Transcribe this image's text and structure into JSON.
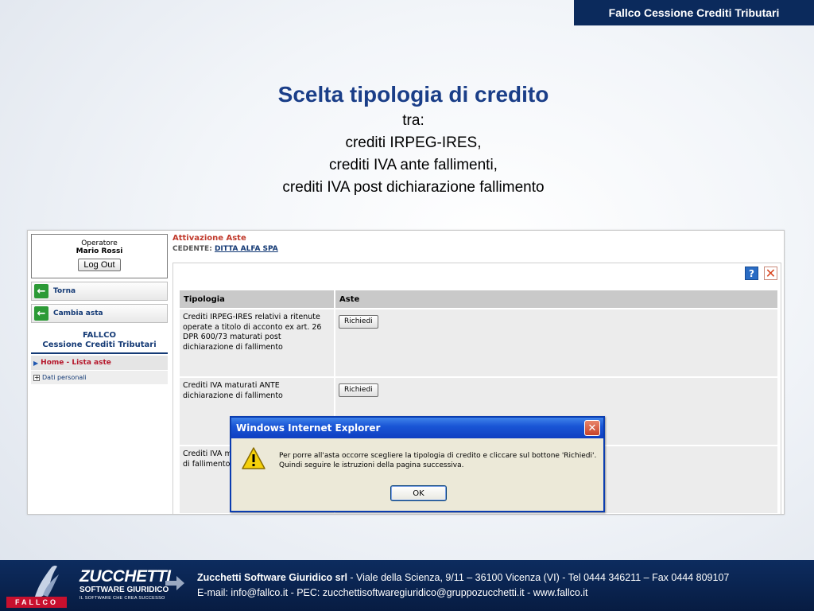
{
  "header_tag": "Fallco Cessione Crediti Tributari",
  "slide": {
    "title": "Scelta tipologia di credito",
    "lines": [
      "tra:",
      "crediti IRPEG-IRES,",
      "crediti IVA ante fallimenti,",
      "crediti IVA post dichiarazione fallimento"
    ]
  },
  "app": {
    "sidebar": {
      "operator_label": "Operatore",
      "operator_name": "Mario Rossi",
      "logout_label": "Log Out",
      "buttons": [
        {
          "label": "Torna",
          "icon": "arrow-left-icon"
        },
        {
          "label": "Cambia asta",
          "icon": "arrow-left-icon"
        }
      ],
      "app_title_1": "FALLCO",
      "app_title_2": "Cessione Crediti Tributari",
      "nav": [
        {
          "label": "Home - Lista aste",
          "icon": "triangle-right-icon",
          "active": true
        },
        {
          "label": "Dati personali",
          "icon": "plus-box-icon",
          "active": false
        }
      ]
    },
    "main": {
      "section_title": "Attivazione Aste",
      "cedente_label": "CEDENTE:",
      "cedente_value": "DITTA ALFA SPA",
      "table": {
        "headers": [
          "Tipologia",
          "Aste"
        ],
        "rows": [
          {
            "tipologia": "Crediti IRPEG-IRES relativi a ritenute operate a titolo di acconto ex art. 26 DPR 600/73 maturati post dichiarazione di fallimento",
            "button": "Richiedi"
          },
          {
            "tipologia": "Crediti IVA maturati ANTE dichiarazione di fallimento",
            "button": "Richiedi"
          },
          {
            "tipologia": "Crediti IVA ma",
            "tipologia_2": "di fallimento",
            "button": ""
          }
        ]
      }
    },
    "dialog": {
      "title": "Windows Internet Explorer",
      "message_1": "Per porre all'asta occorre scegliere la tipologia di credito e cliccare sul bottone 'Richiedi'.",
      "message_2": "Quindi seguire le istruzioni della pagina successiva.",
      "ok_label": "OK"
    }
  },
  "footer": {
    "logo_text": "FALLCO",
    "brand_1": "ZUCCHETTI",
    "brand_2": "SOFTWARE GIURIDICO",
    "brand_3": "IL SOFTWARE CHE CREA SUCCESSO",
    "company": "Zucchetti Software Giuridico srl",
    "line_1_rest": " - Viale della Scienza, 9/11 – 36100 Vicenza (VI) - Tel 0444 346211 – Fax 0444 809107",
    "line_2": "E-mail: info@fallco.it - PEC: zucchettisoftwaregiuridico@gruppozucchetti.it - www.fallco.it"
  },
  "colors": {
    "title_blue": "#1a3e88",
    "navy": "#0b2a5c",
    "accent_red": "#c0392b",
    "xp_blue": "#0e3ec1"
  }
}
